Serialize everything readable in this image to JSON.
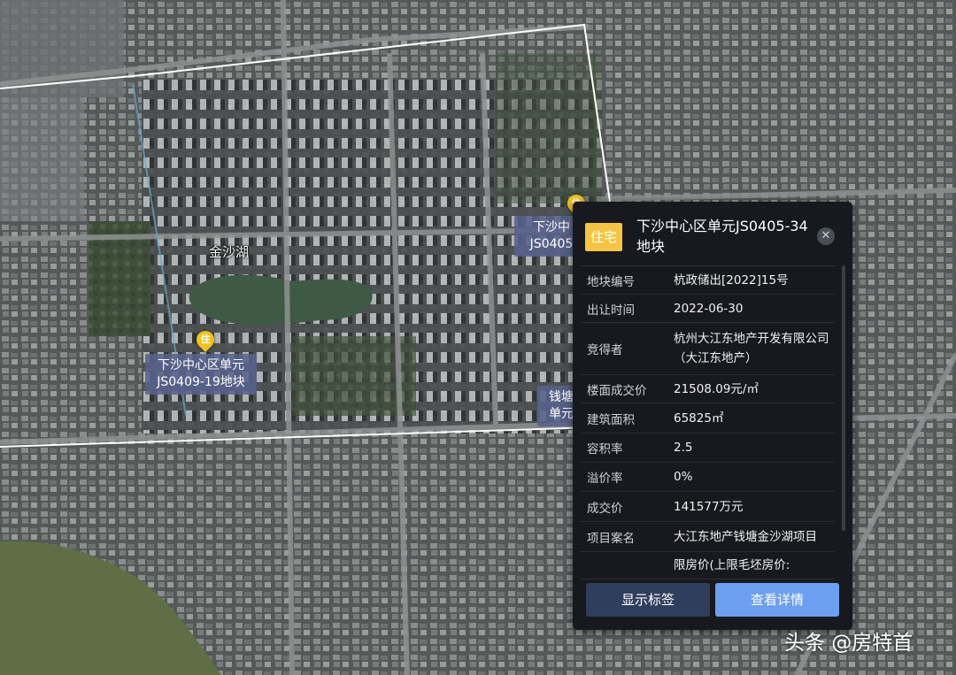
{
  "map": {
    "labels": {
      "lake": "金沙湖"
    },
    "parcels": [
      {
        "marker": "住",
        "line1": "下沙中心区单元",
        "line2": "JS0409-19地块"
      },
      {
        "marker": "住",
        "line1": "下沙中",
        "line2": "JS0405"
      },
      {
        "line1": "钱塘",
        "line2": "单元"
      }
    ]
  },
  "panel": {
    "badge": "住宅",
    "title": "下沙中心区单元JS0405-34地块",
    "close_icon": "close-icon",
    "rows": [
      {
        "key": "地块编号",
        "value": "杭政储出[2022]15号"
      },
      {
        "key": "出让时间",
        "value": "2022-06-30"
      },
      {
        "key": "竞得者",
        "value": "杭州大江东地产开发有限公司（大江东地产）"
      },
      {
        "key": "楼面成交价",
        "value": "21508.09元/㎡"
      },
      {
        "key": "建筑面积",
        "value": "65825㎡"
      },
      {
        "key": "容积率",
        "value": "2.5"
      },
      {
        "key": "溢价率",
        "value": "0%"
      },
      {
        "key": "成交价",
        "value": "141577万元"
      },
      {
        "key": "项目案名",
        "value": "大江东地产钱塘金沙湖项目"
      },
      {
        "key": "",
        "value": "限房价(上限毛坯房价:"
      }
    ],
    "buttons": {
      "show_labels": "显示标签",
      "view_details": "查看详情"
    }
  },
  "watermark": "头条 @房特首",
  "colors": {
    "badge": "#f5c542",
    "primary_button": "#6d9ff0",
    "secondary_button": "#2f3e5c",
    "marker": "#f0c419"
  }
}
